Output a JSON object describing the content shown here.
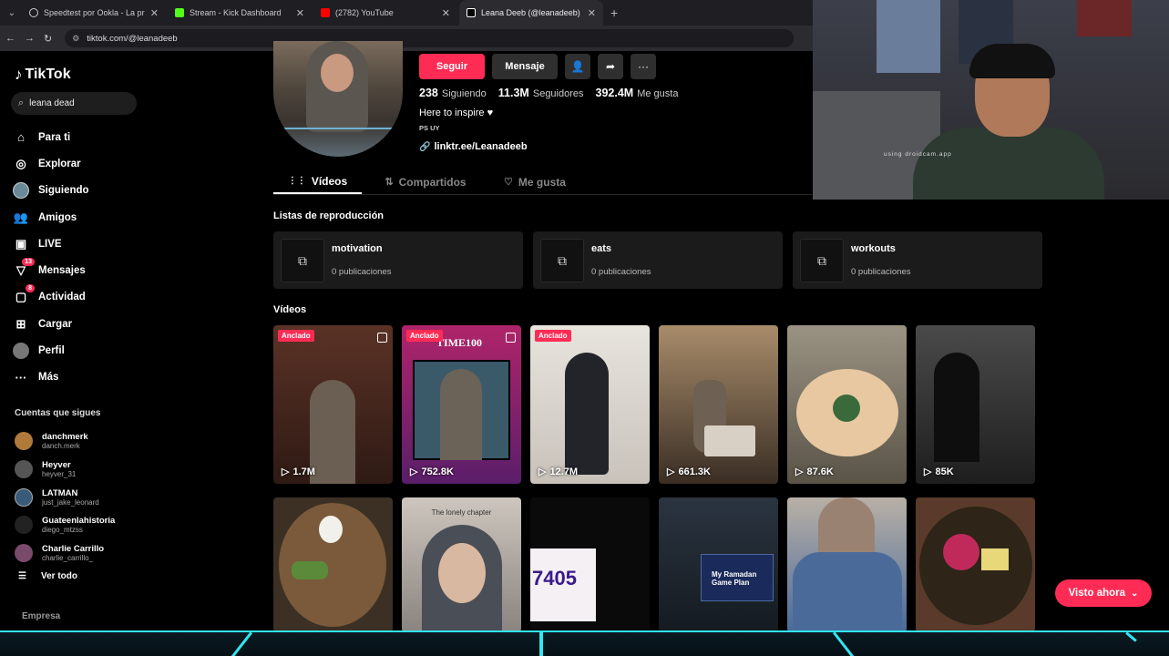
{
  "browser": {
    "tabs": [
      {
        "title": "Speedtest por Ookla - La prueb",
        "color": "#ffffff"
      },
      {
        "title": "Stream - Kick Dashboard",
        "color": "#53fc18"
      },
      {
        "title": "(2782) YouTube",
        "color": "#ff0000"
      },
      {
        "title": "Leana Deeb (@leanadeeb) | Tik",
        "color": "#ffffff"
      }
    ],
    "url": "tiktok.com/@leanadeeb"
  },
  "sidebar": {
    "logo": "TikTok",
    "search_value": "leana dead",
    "nav": [
      {
        "label": "Para ti",
        "icon": "home-icon"
      },
      {
        "label": "Explorar",
        "icon": "compass-icon"
      },
      {
        "label": "Siguiendo",
        "icon": "following-avatar-icon"
      },
      {
        "label": "Amigos",
        "icon": "friends-icon"
      },
      {
        "label": "LIVE",
        "icon": "live-icon"
      },
      {
        "label": "Mensajes",
        "icon": "messages-icon",
        "badge": "13"
      },
      {
        "label": "Actividad",
        "icon": "activity-icon",
        "badge": "8"
      },
      {
        "label": "Cargar",
        "icon": "upload-icon"
      },
      {
        "label": "Perfil",
        "icon": "profile-icon"
      },
      {
        "label": "Más",
        "icon": "more-icon"
      }
    ],
    "following_title": "Cuentas que sigues",
    "accounts": [
      {
        "name": "danchmerk",
        "user": "danch.merk",
        "color": "#b07a3a"
      },
      {
        "name": "Heyver",
        "user": "heyver_31",
        "color": "#555555"
      },
      {
        "name": "LATMAN",
        "user": "just_jake_leonard",
        "color": "#3a5a7a"
      },
      {
        "name": "Guateenlahistoria",
        "user": "diego_mtzss",
        "color": "#222222"
      },
      {
        "name": "Charlie Carrillo",
        "user": "charlie_carrillo_",
        "color": "#7a4a6a"
      }
    ],
    "see_all": "Ver todo",
    "footer": "Empresa"
  },
  "profile": {
    "follow": "Seguir",
    "message": "Mensaje",
    "stats": [
      {
        "value": "238",
        "label": "Siguiendo"
      },
      {
        "value": "11.3M",
        "label": "Seguidores"
      },
      {
        "value": "392.4M",
        "label": "Me gusta"
      }
    ],
    "bio": "Here to inspire ♥",
    "bio_sub": "PS UY",
    "link": "linktr.ee/Leanadeeb"
  },
  "tabs": [
    {
      "label": "Vídeos",
      "icon": "grid-icon"
    },
    {
      "label": "Compartidos",
      "icon": "repost-icon"
    },
    {
      "label": "Me gusta",
      "icon": "heart-icon"
    }
  ],
  "playlists_title": "Listas de reproducción",
  "playlists": [
    {
      "name": "motivation",
      "count": "0 publicaciones"
    },
    {
      "name": "eats",
      "count": "0 publicaciones"
    },
    {
      "name": "workouts",
      "count": "0 publicaciones"
    }
  ],
  "videos_title": "Vídeos",
  "videos_row1": [
    {
      "views": "1.7M",
      "pinned": "Anclado",
      "bg": "#4a2a22"
    },
    {
      "views": "752.8K",
      "pinned": "Anclado",
      "bg": "#8a2a5a"
    },
    {
      "views": "12.7M",
      "pinned": "Anclado",
      "bg": "#d8d4cc"
    },
    {
      "views": "661.3K",
      "pinned": "",
      "bg": "#6e5a44"
    },
    {
      "views": "87.6K",
      "pinned": "",
      "bg": "#8a8072"
    },
    {
      "views": "85K",
      "pinned": "",
      "bg": "#3a3a3a"
    }
  ],
  "videos_row2": [
    {
      "bg": "#3c3024"
    },
    {
      "bg": "#c8c0b8",
      "caption": "The lonely chapter"
    },
    {
      "bg": "#0a0a0a",
      "caption": "7405"
    },
    {
      "bg": "#2a3a48",
      "caption": "My Ramadan Game Plan"
    },
    {
      "bg": "#4a6a9a"
    },
    {
      "bg": "#5a3a2a"
    }
  ],
  "float_button": "Visto ahora",
  "webcam_watermark": "using droidcam.app"
}
